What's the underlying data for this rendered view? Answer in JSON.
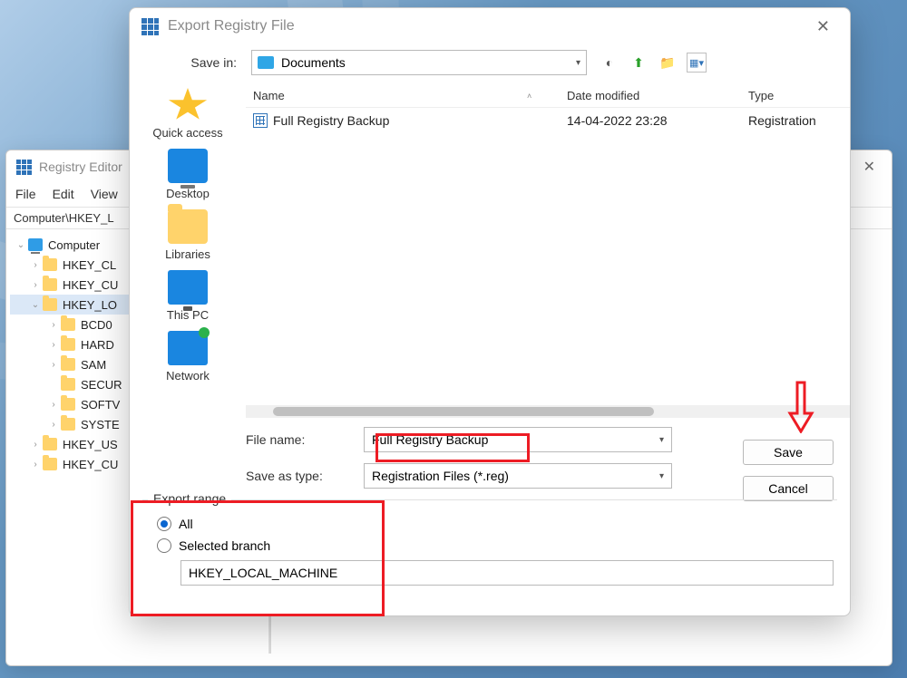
{
  "regedit": {
    "title": "Registry Editor",
    "menu": {
      "file": "File",
      "edit": "Edit",
      "view": "View"
    },
    "address": "Computer\\HKEY_L",
    "tree": {
      "root": "Computer",
      "hkcl": "HKEY_CL",
      "hkcu": "HKEY_CU",
      "hklo": "HKEY_LO",
      "bcd0": "BCD0",
      "hard": "HARD",
      "sam": "SAM",
      "secur": "SECUR",
      "softv": "SOFTV",
      "syste": "SYSTE",
      "hkus": "HKEY_US",
      "hkcu2": "HKEY_CU"
    }
  },
  "dialog": {
    "title": "Export Registry File",
    "savein_label": "Save in:",
    "savein_value": "Documents",
    "places": {
      "quickaccess": "Quick access",
      "desktop": "Desktop",
      "libraries": "Libraries",
      "thispc": "This PC",
      "network": "Network"
    },
    "columns": {
      "name": "Name",
      "date": "Date modified",
      "type": "Type"
    },
    "files": [
      {
        "name": "Full Registry Backup",
        "date": "14-04-2022 23:28",
        "type": "Registration"
      }
    ],
    "filename_label": "File name:",
    "filename_value": "Full Registry Backup",
    "saveas_label": "Save as type:",
    "saveas_value": "Registration Files (*.reg)",
    "save_btn": "Save",
    "cancel_btn": "Cancel",
    "export_range": {
      "legend": "Export range",
      "all": "All",
      "selected": "Selected branch",
      "branch_value": "HKEY_LOCAL_MACHINE"
    }
  }
}
